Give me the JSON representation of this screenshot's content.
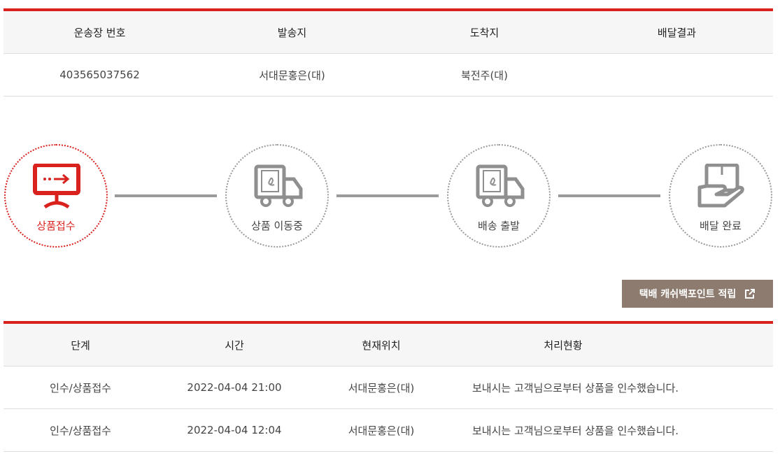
{
  "summary": {
    "headers": [
      "운송장 번호",
      "발송지",
      "도착지",
      "배달결과"
    ],
    "row": [
      "403565037562",
      "서대문홍은(대)",
      "북전주(대)",
      ""
    ]
  },
  "steps": [
    {
      "label": "상품접수",
      "icon": "monitor-arrow-icon",
      "active": true
    },
    {
      "label": "상품 이동중",
      "icon": "truck-icon",
      "active": false
    },
    {
      "label": "배송 출발",
      "icon": "truck-icon",
      "active": false
    },
    {
      "label": "배달 완료",
      "icon": "hand-box-icon",
      "active": false
    }
  ],
  "point_button": {
    "label": "택배 캐쉬백포인트 적립",
    "icon": "external-link-icon"
  },
  "details": {
    "headers": [
      "단계",
      "시간",
      "현재위치",
      "처리현황"
    ],
    "rows": [
      [
        "인수/상품접수",
        "2022-04-04 21:00",
        "서대문홍은(대)",
        "보내시는 고객님으로부터 상품을 인수했습니다."
      ],
      [
        "인수/상품접수",
        "2022-04-04 12:04",
        "서대문홍은(대)",
        "보내시는 고객님으로부터 상품을 인수했습니다."
      ]
    ]
  },
  "colors": {
    "accent": "#d9211e",
    "inactive": "#9a9a9a",
    "button": "#8c7b6e",
    "header_bg": "#f6f6f6"
  }
}
